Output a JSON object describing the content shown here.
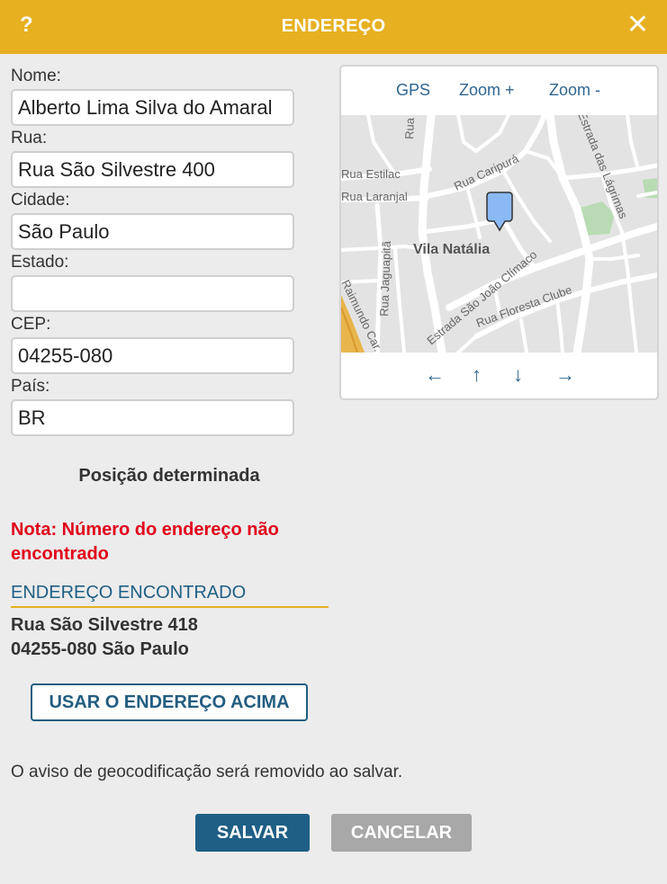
{
  "dialog": {
    "title": "ENDEREÇO",
    "help_glyph": "?",
    "close_glyph": "✕"
  },
  "form": {
    "name_label": "Nome:",
    "name_value": "Alberto Lima Silva do Amaral",
    "street_label": "Rua:",
    "street_value": "Rua São Silvestre 400",
    "city_label": "Cidade:",
    "city_value": "São Paulo",
    "state_label": "Estado:",
    "state_value": "",
    "zip_label": "CEP:",
    "zip_value": "04255-080",
    "country_label": "País:",
    "country_value": "BR"
  },
  "map": {
    "gps_label": "GPS",
    "zoom_in_label": "Zoom +",
    "zoom_out_label": "Zoom -",
    "nav": {
      "left": "←",
      "up": "↑",
      "down": "↓",
      "right": "→"
    },
    "labels": {
      "araripe": "Rua Araripe",
      "estilac": "Rua Estilac",
      "laranjal": "Rua Laranjal",
      "caripura": "Rua Caripurá",
      "lagrimas": "Estrada das Lágrimas",
      "jaguapita": "Rua Jaguapitã",
      "vila": "Vila Natália",
      "joao": "Estrada São João Clímaco",
      "floresta": "Rua Floresta Clube",
      "mundo": "Raimundo Car..."
    }
  },
  "status": {
    "position_text": "Posição determinada",
    "note_text": "Nota: Número do endereço não encontrado"
  },
  "found": {
    "heading": "ENDEREÇO ENCONTRADO",
    "line1": "Rua São Silvestre 418",
    "line2": "04255-080 São Paulo"
  },
  "actions": {
    "use_address": "USAR O ENDEREÇO ACIMA",
    "geocode_warning": "O aviso de geocodificação será removido ao salvar.",
    "save": "SALVAR",
    "cancel": "CANCELAR"
  },
  "colors": {
    "header": "#e6b021",
    "primary": "#1f5f85",
    "error": "#e0001a",
    "marker": "#8ab9f4"
  }
}
